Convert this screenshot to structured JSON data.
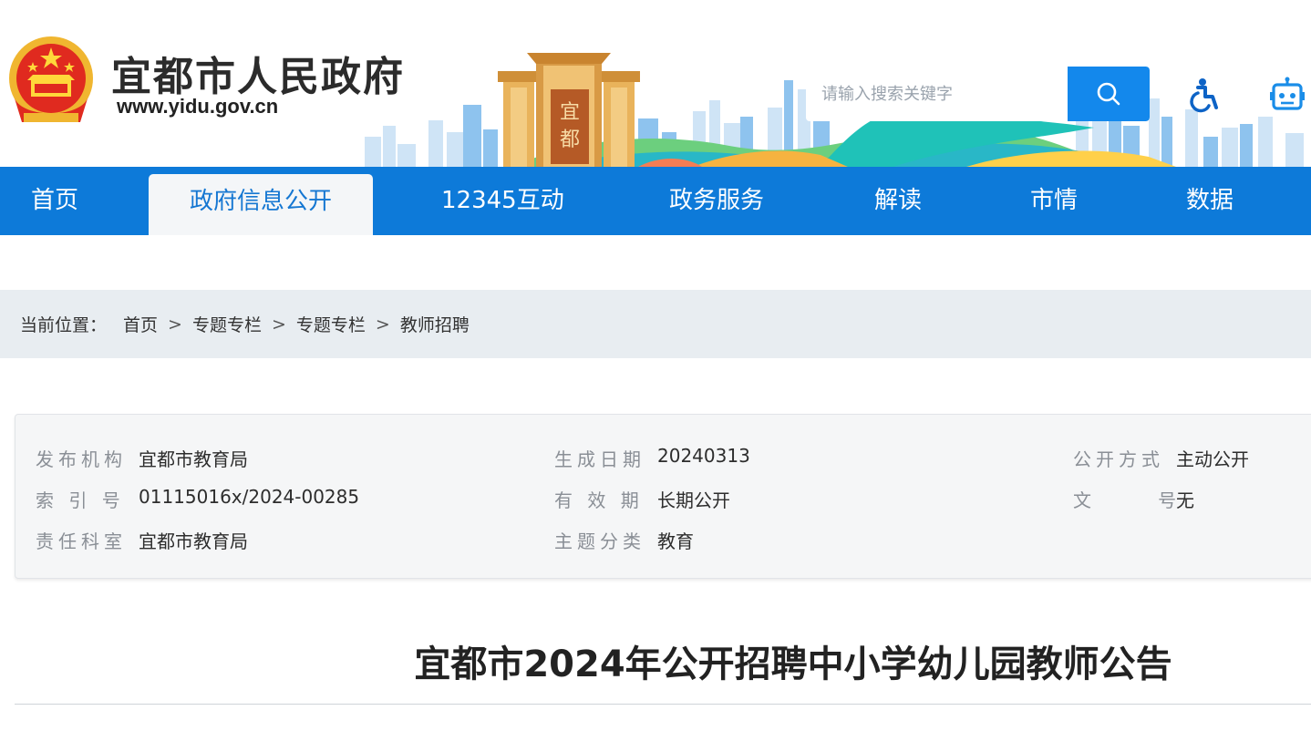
{
  "header": {
    "site_title": "宜都市人民政府",
    "site_url": "www.yidu.gov.cn",
    "search": {
      "placeholder": "请输入搜索关键字"
    },
    "colors": {
      "brand_blue": "#0d7ad9",
      "search_button": "#1388ec"
    }
  },
  "nav": {
    "items": [
      {
        "label": "首页"
      },
      {
        "label": "政府信息公开"
      },
      {
        "label": "12345互动"
      },
      {
        "label": "政务服务"
      },
      {
        "label": "解读"
      },
      {
        "label": "市情"
      },
      {
        "label": "数据"
      }
    ],
    "active_index": 1
  },
  "breadcrumb": {
    "label": "当前位置：",
    "items": [
      "首页",
      "专题专栏",
      "专题专栏",
      "教师招聘"
    ],
    "separator": ">"
  },
  "meta": {
    "publisher": {
      "label": "发布机构",
      "value": "宜都市教育局"
    },
    "generated_date": {
      "label": "生成日期",
      "value": "20240313"
    },
    "disclosure_method": {
      "label": "公开方式",
      "value": "主动公开"
    },
    "index_no": {
      "label": "索 引 号",
      "value": "01115016x/2024-00285"
    },
    "validity": {
      "label": "有 效 期",
      "value": "长期公开"
    },
    "doc_no": {
      "label": "文      号",
      "value": "无"
    },
    "responsible_dept": {
      "label": "责任科室",
      "value": "宜都市教育局"
    },
    "topic": {
      "label": "主题分类",
      "value": "教育"
    }
  },
  "article": {
    "title": "宜都市2024年公开招聘中小学幼儿园教师公告"
  }
}
